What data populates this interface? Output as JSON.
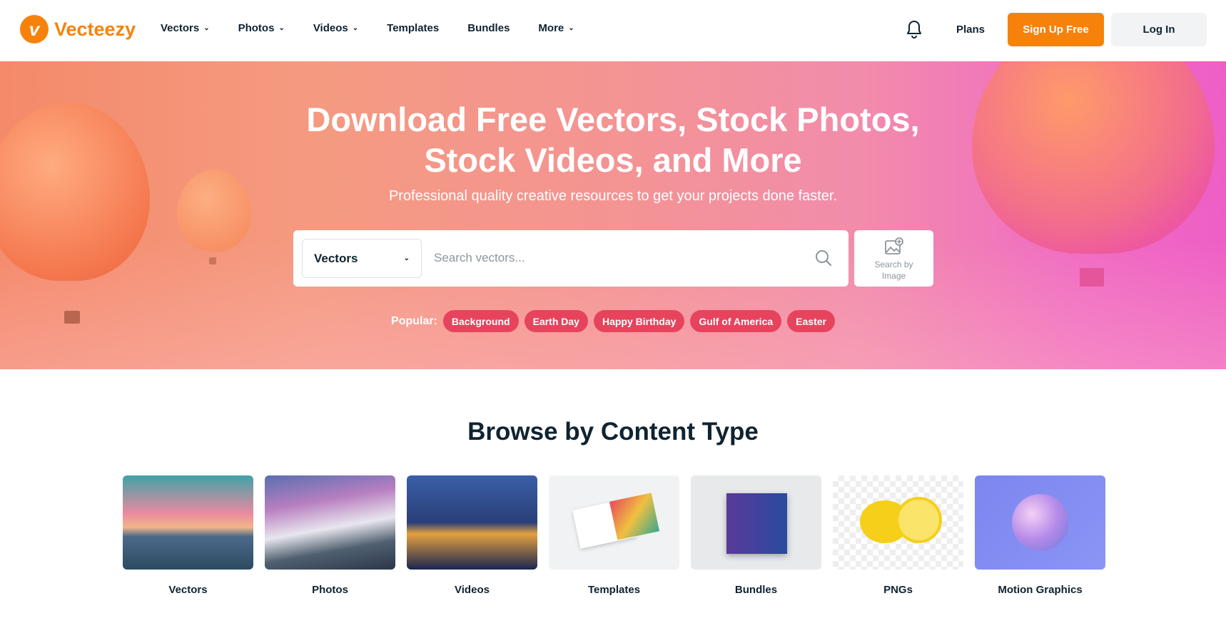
{
  "header": {
    "logo_mark": "v",
    "logo_text": "Vecteezy",
    "nav": [
      {
        "label": "Vectors",
        "dropdown": true
      },
      {
        "label": "Photos",
        "dropdown": true
      },
      {
        "label": "Videos",
        "dropdown": true
      },
      {
        "label": "Templates",
        "dropdown": false
      },
      {
        "label": "Bundles",
        "dropdown": false
      },
      {
        "label": "More",
        "dropdown": true
      }
    ],
    "plans": "Plans",
    "signup": "Sign Up Free",
    "login": "Log In"
  },
  "hero": {
    "title_line1": "Download Free Vectors, Stock Photos,",
    "title_line2": "Stock Videos, and More",
    "subtitle": "Professional quality creative resources to get your projects done faster.",
    "search": {
      "type": "Vectors",
      "placeholder": "Search vectors...",
      "by_image_1": "Search by",
      "by_image_2": "Image"
    },
    "popular_label": "Popular:",
    "popular": [
      "Background",
      "Earth Day",
      "Happy Birthday",
      "Gulf of America",
      "Easter"
    ]
  },
  "browse": {
    "title": "Browse by Content Type",
    "items": [
      "Vectors",
      "Photos",
      "Videos",
      "Templates",
      "Bundles",
      "PNGs",
      "Motion Graphics"
    ]
  },
  "colors": {
    "brand": "#f6820c",
    "tag": "#e7435d",
    "text": "#0f2331"
  }
}
